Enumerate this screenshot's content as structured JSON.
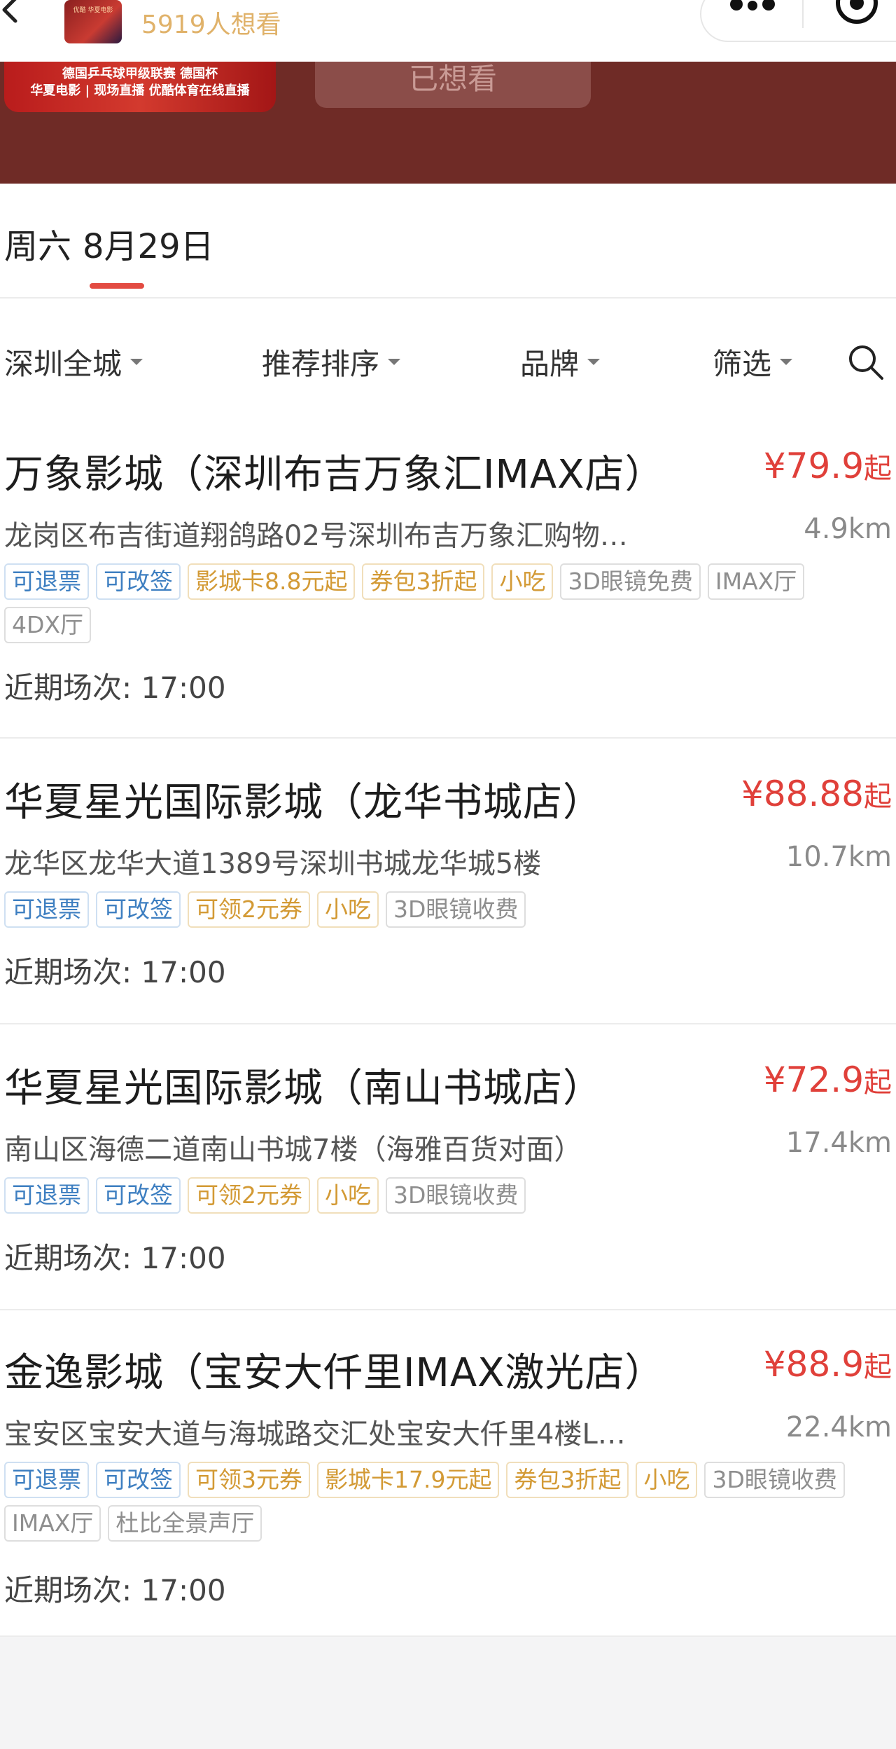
{
  "header": {
    "want_count": "5919人想看",
    "poster_line1": "德国乒乓球甲级联赛 德国杯",
    "poster_line2": "华夏电影 | 现场直播  优酷体育在线直播",
    "mini_poster_text": "优酷 华夏电影",
    "wanted_button": "已想看"
  },
  "date_tab": {
    "weekday": "周六",
    "date": "8月29日"
  },
  "filters": [
    {
      "label": "深圳全城"
    },
    {
      "label": "推荐排序"
    },
    {
      "label": "品牌"
    },
    {
      "label": "筛选"
    }
  ],
  "cinemas": [
    {
      "name": "万象影城（深圳布吉万象汇IMAX店）",
      "price": "¥79.9",
      "price_suffix": "起",
      "address": "龙岗区布吉街道翔鸽路02号深圳布吉万象汇购物…",
      "distance": "4.9km",
      "tags": [
        {
          "text": "可退票",
          "color": "blue"
        },
        {
          "text": "可改签",
          "color": "blue"
        },
        {
          "text": "影城卡8.8元起",
          "color": "orange"
        },
        {
          "text": "券包3折起",
          "color": "orange"
        },
        {
          "text": "小吃",
          "color": "orange"
        },
        {
          "text": "3D眼镜免费",
          "color": "gray"
        },
        {
          "text": "IMAX厅",
          "color": "gray"
        },
        {
          "text": "4DX厅",
          "color": "gray"
        }
      ],
      "session": "近期场次: 17:00"
    },
    {
      "name": "华夏星光国际影城（龙华书城店）",
      "price": "¥88.88",
      "price_suffix": "起",
      "address": "龙华区龙华大道1389号深圳书城龙华城5楼",
      "distance": "10.7km",
      "tags": [
        {
          "text": "可退票",
          "color": "blue"
        },
        {
          "text": "可改签",
          "color": "blue"
        },
        {
          "text": "可领2元券",
          "color": "orange"
        },
        {
          "text": "小吃",
          "color": "orange"
        },
        {
          "text": "3D眼镜收费",
          "color": "gray"
        }
      ],
      "session": "近期场次: 17:00"
    },
    {
      "name": "华夏星光国际影城（南山书城店）",
      "price": "¥72.9",
      "price_suffix": "起",
      "address": "南山区海德二道南山书城7楼（海雅百货对面）",
      "distance": "17.4km",
      "tags": [
        {
          "text": "可退票",
          "color": "blue"
        },
        {
          "text": "可改签",
          "color": "blue"
        },
        {
          "text": "可领2元券",
          "color": "orange"
        },
        {
          "text": "小吃",
          "color": "orange"
        },
        {
          "text": "3D眼镜收费",
          "color": "gray"
        }
      ],
      "session": "近期场次: 17:00"
    },
    {
      "name": "金逸影城（宝安大仟里IMAX激光店）",
      "price": "¥88.9",
      "price_suffix": "起",
      "address": "宝安区宝安大道与海城路交汇处宝安大仟里4楼L…",
      "distance": "22.4km",
      "tags": [
        {
          "text": "可退票",
          "color": "blue"
        },
        {
          "text": "可改签",
          "color": "blue"
        },
        {
          "text": "可领3元券",
          "color": "orange"
        },
        {
          "text": "影城卡17.9元起",
          "color": "orange"
        },
        {
          "text": "券包3折起",
          "color": "orange"
        },
        {
          "text": "小吃",
          "color": "orange"
        },
        {
          "text": "3D眼镜收费",
          "color": "gray"
        },
        {
          "text": "IMAX厅",
          "color": "gray"
        },
        {
          "text": "杜比全景声厅",
          "color": "gray"
        }
      ],
      "session": "近期场次: 17:00"
    }
  ],
  "colors": {
    "accent_red": "#e0403a",
    "banner": "#6f2b26",
    "tag_blue": "#3e7fc1",
    "tag_orange": "#d39a35"
  }
}
